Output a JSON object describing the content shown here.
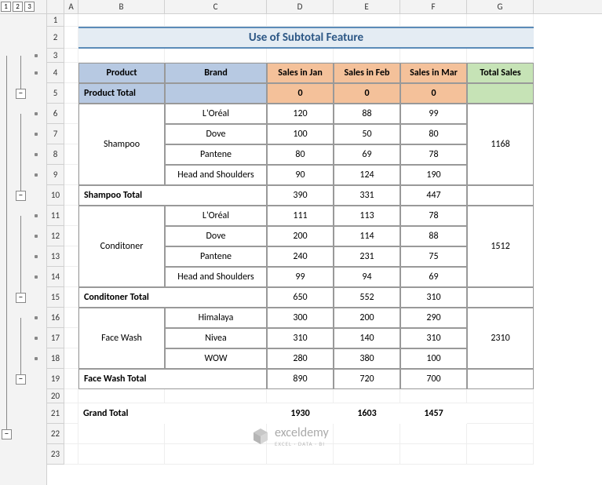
{
  "outline": {
    "levels": [
      "1",
      "2",
      "3"
    ],
    "minus": "−"
  },
  "columns": [
    "",
    "A",
    "B",
    "C",
    "D",
    "E",
    "F",
    "G"
  ],
  "rows": [
    "1",
    "2",
    "3",
    "4",
    "5",
    "6",
    "7",
    "8",
    "9",
    "10",
    "11",
    "12",
    "13",
    "14",
    "15",
    "16",
    "17",
    "18",
    "19",
    "20",
    "21",
    "22",
    "23"
  ],
  "title": "Use of Subtotal Feature",
  "headers": {
    "product": "Product",
    "brand": "Brand",
    "jan": "Sales in Jan",
    "feb": "Sales in Feb",
    "mar": "Sales in Mar",
    "total": "Total Sales"
  },
  "productTotal": {
    "label": "Product Total",
    "jan": "0",
    "feb": "0",
    "mar": "0"
  },
  "groups": [
    {
      "name": "Shampoo",
      "rows": [
        {
          "brand": "L'Oréal",
          "jan": "120",
          "feb": "88",
          "mar": "99"
        },
        {
          "brand": "Dove",
          "jan": "100",
          "feb": "50",
          "mar": "80"
        },
        {
          "brand": "Pantene",
          "jan": "80",
          "feb": "69",
          "mar": "78"
        },
        {
          "brand": "Head and Shoulders",
          "jan": "90",
          "feb": "124",
          "mar": "190"
        }
      ],
      "total": "1168",
      "subtotal": {
        "label": "Shampoo Total",
        "jan": "390",
        "feb": "331",
        "mar": "447"
      }
    },
    {
      "name": "Conditoner",
      "rows": [
        {
          "brand": "L'Oréal",
          "jan": "111",
          "feb": "113",
          "mar": "78"
        },
        {
          "brand": "Dove",
          "jan": "200",
          "feb": "114",
          "mar": "88"
        },
        {
          "brand": "Pantene",
          "jan": "240",
          "feb": "231",
          "mar": "75"
        },
        {
          "brand": "Head and Shoulders",
          "jan": "99",
          "feb": "94",
          "mar": "69"
        }
      ],
      "total": "1512",
      "subtotal": {
        "label": "Conditoner Total",
        "jan": "650",
        "feb": "552",
        "mar": "310"
      }
    },
    {
      "name": "Face Wash",
      "rows": [
        {
          "brand": "Himalaya",
          "jan": "300",
          "feb": "200",
          "mar": "290"
        },
        {
          "brand": "Nivea",
          "jan": "310",
          "feb": "140",
          "mar": "310"
        },
        {
          "brand": "WOW",
          "jan": "280",
          "feb": "380",
          "mar": "100"
        }
      ],
      "total": "2310",
      "subtotal": {
        "label": "Face Wash Total",
        "jan": "890",
        "feb": "720",
        "mar": "700"
      }
    }
  ],
  "grandTotal": {
    "label": "Grand Total",
    "jan": "1930",
    "feb": "1603",
    "mar": "1457"
  },
  "logo": {
    "name": "exceldemy",
    "sub": "EXCEL · DATA · BI"
  },
  "chart_data": {
    "type": "table",
    "title": "Use of Subtotal Feature",
    "columns": [
      "Product",
      "Brand",
      "Sales in Jan",
      "Sales in Feb",
      "Sales in Mar",
      "Total Sales"
    ],
    "rows": [
      [
        "Product Total",
        "",
        0,
        0,
        0,
        null
      ],
      [
        "Shampoo",
        "L'Oréal",
        120,
        88,
        99,
        null
      ],
      [
        "Shampoo",
        "Dove",
        100,
        50,
        80,
        null
      ],
      [
        "Shampoo",
        "Pantene",
        80,
        69,
        78,
        null
      ],
      [
        "Shampoo",
        "Head and Shoulders",
        90,
        124,
        190,
        null
      ],
      [
        "Shampoo Total",
        "",
        390,
        331,
        447,
        1168
      ],
      [
        "Conditoner",
        "L'Oréal",
        111,
        113,
        78,
        null
      ],
      [
        "Conditoner",
        "Dove",
        200,
        114,
        88,
        null
      ],
      [
        "Conditoner",
        "Pantene",
        240,
        231,
        75,
        null
      ],
      [
        "Conditoner",
        "Head and Shoulders",
        99,
        94,
        69,
        null
      ],
      [
        "Conditoner Total",
        "",
        650,
        552,
        310,
        1512
      ],
      [
        "Face Wash",
        "Himalaya",
        300,
        200,
        290,
        null
      ],
      [
        "Face Wash",
        "Nivea",
        310,
        140,
        310,
        null
      ],
      [
        "Face Wash",
        "WOW",
        280,
        380,
        100,
        null
      ],
      [
        "Face Wash Total",
        "",
        890,
        720,
        700,
        2310
      ],
      [
        "Grand Total",
        "",
        1930,
        1603,
        1457,
        null
      ]
    ]
  }
}
